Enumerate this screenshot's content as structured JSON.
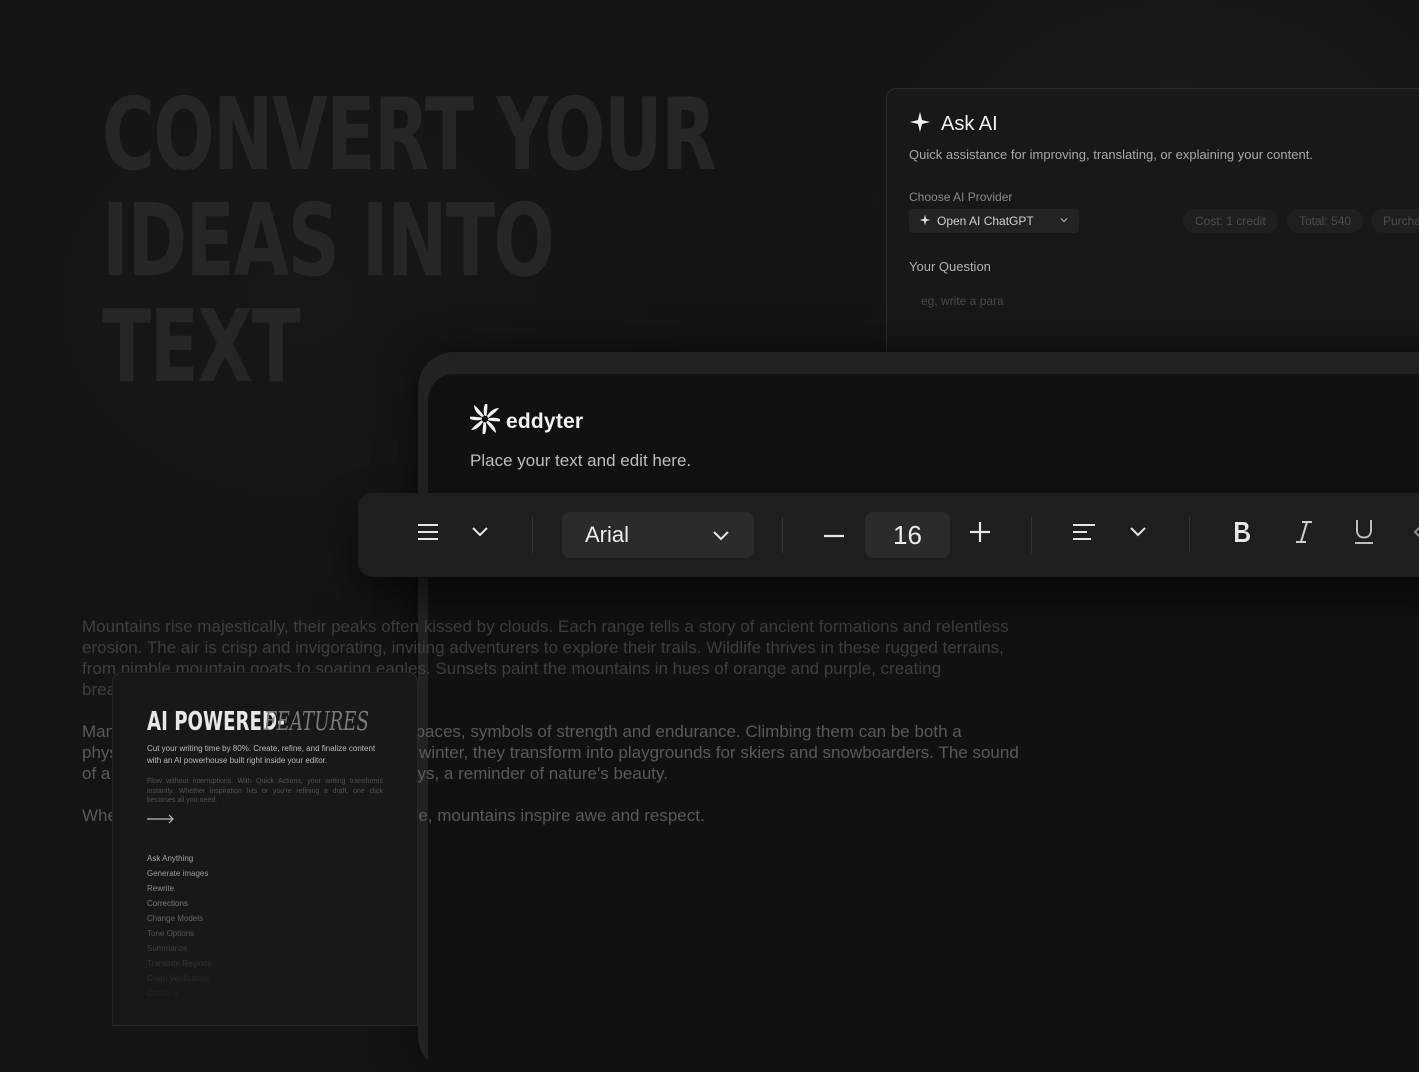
{
  "hero": {
    "lines": [
      "Convert your",
      "ideas into",
      "text"
    ]
  },
  "ask_ai": {
    "title": "Ask AI",
    "subtitle": "Quick assistance for improving, translating, or explaining your content.",
    "provider_label": "Choose AI Provider",
    "provider_value": "Open AI ChatGPT",
    "cost": "Cost: 1 credit",
    "total": "Total: 540",
    "purchase": "Purcha",
    "question_label": "Your Question",
    "question_placeholder": "eg, write a para"
  },
  "editor": {
    "brand": "eddyter",
    "placeholder": "Place your text and edit here.",
    "paragraphs": [
      "Mountains rise majestically, their peaks often kissed by clouds. Each range tells a story of ancient formations and relentless erosion. The air is crisp and invigorating, inviting adventurers to explore their trails. Wildlife thrives in these rugged terrains, from nimble mountain goats to soaring eagles. Sunsets paint the mountains in hues of orange and purple, creating breathtaking vistas.",
      "Many cultures revere mountains as sacred spaces, symbols of strength and endurance. Climbing them can be both a physical challenge and a spiritual journey. In winter, they transform into playgrounds for skiers and snowboarders. The sound of a rushing stream echoes through the valleys, a reminder of nature's beauty.",
      "Whether viewed from afar or climbed up close, mountains inspire awe and respect."
    ]
  },
  "toolbar": {
    "font_family": "Arial",
    "font_size": "16"
  },
  "features": {
    "title": "AI POWERED-",
    "title_accent": "FEATURES",
    "desc": "Cut your writing time by 80%. Create, refine, and finalize content with an AI powerhouse built right inside your editor.",
    "desc2": "Flow without interruptions. With Quick Actions, your writing transforms instantly. Whether inspiration hits or you're refining a draft, one click becomes all you need.",
    "items": [
      "Ask Anything",
      "Generate images",
      "Rewrite",
      "Corrections",
      "Change Models",
      "Tone Options",
      "Summarize",
      "Translate Regions",
      "Claim Verification",
      "Citations"
    ]
  },
  "colors": {
    "background": "#141414",
    "toolbar": "#1e1e1e",
    "hero_text": "#262626"
  }
}
